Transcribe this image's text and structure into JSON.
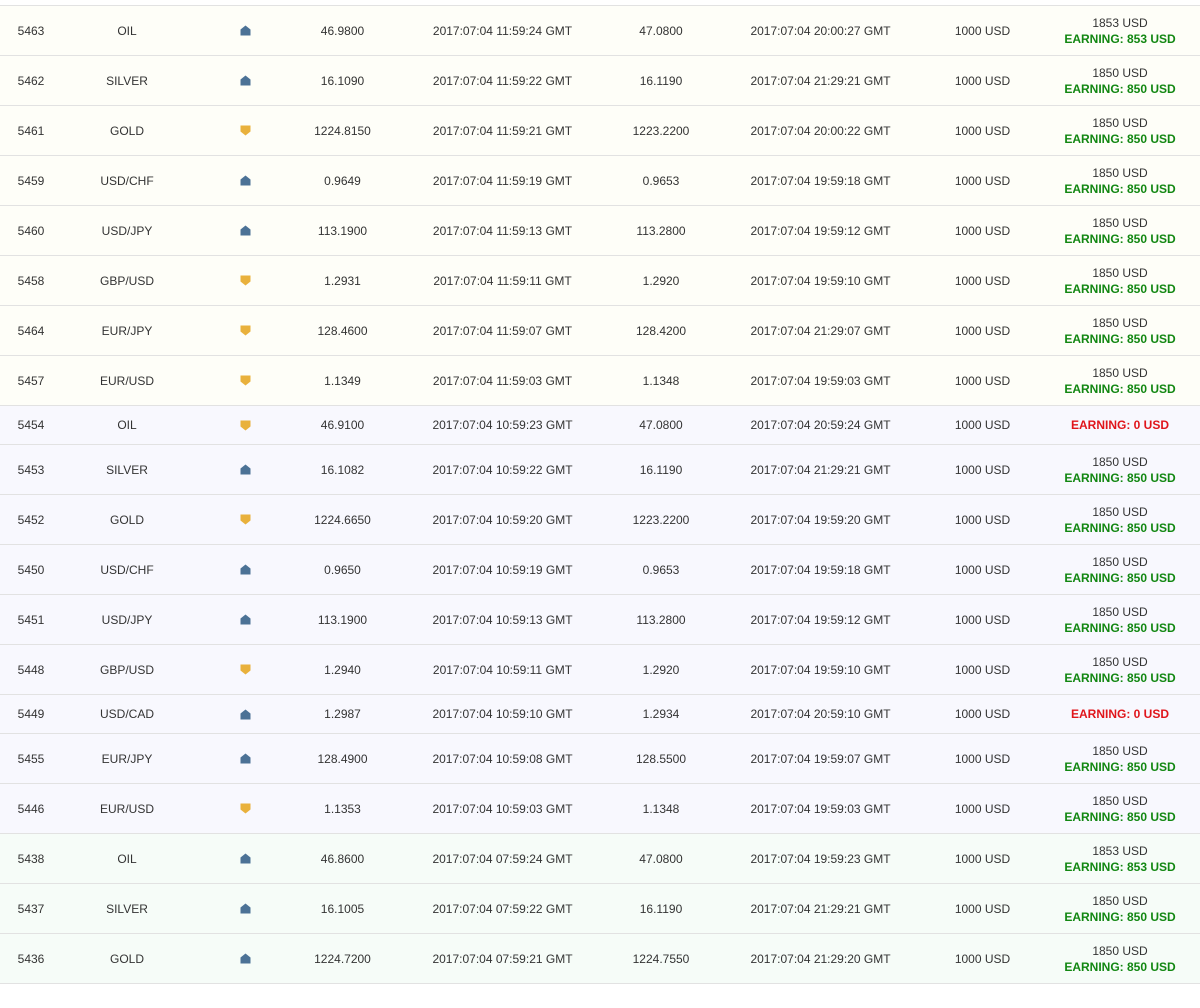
{
  "colors": {
    "up": "#4c7296",
    "down": "#e9b13c",
    "earning_positive": "#128712",
    "earning_zero": "#e0151b"
  },
  "trades": [
    {
      "id": "5463",
      "asset": "OIL",
      "direction": "up",
      "open_price": "46.9800",
      "open_time": "2017:07:04 11:59:24 GMT",
      "close_price": "47.0800",
      "close_time": "2017:07:04 20:00:27 GMT",
      "investment": "1000 USD",
      "payout": "1853 USD",
      "earning": "EARNING: 853 USD",
      "group": "yellow"
    },
    {
      "id": "5462",
      "asset": "SILVER",
      "direction": "up",
      "open_price": "16.1090",
      "open_time": "2017:07:04 11:59:22 GMT",
      "close_price": "16.1190",
      "close_time": "2017:07:04 21:29:21 GMT",
      "investment": "1000 USD",
      "payout": "1850 USD",
      "earning": "EARNING: 850 USD",
      "group": "yellow"
    },
    {
      "id": "5461",
      "asset": "GOLD",
      "direction": "down",
      "open_price": "1224.8150",
      "open_time": "2017:07:04 11:59:21 GMT",
      "close_price": "1223.2200",
      "close_time": "2017:07:04 20:00:22 GMT",
      "investment": "1000 USD",
      "payout": "1850 USD",
      "earning": "EARNING: 850 USD",
      "group": "yellow"
    },
    {
      "id": "5459",
      "asset": "USD/CHF",
      "direction": "up",
      "open_price": "0.9649",
      "open_time": "2017:07:04 11:59:19 GMT",
      "close_price": "0.9653",
      "close_time": "2017:07:04 19:59:18 GMT",
      "investment": "1000 USD",
      "payout": "1850 USD",
      "earning": "EARNING: 850 USD",
      "group": "yellow"
    },
    {
      "id": "5460",
      "asset": "USD/JPY",
      "direction": "up",
      "open_price": "113.1900",
      "open_time": "2017:07:04 11:59:13 GMT",
      "close_price": "113.2800",
      "close_time": "2017:07:04 19:59:12 GMT",
      "investment": "1000 USD",
      "payout": "1850 USD",
      "earning": "EARNING: 850 USD",
      "group": "yellow"
    },
    {
      "id": "5458",
      "asset": "GBP/USD",
      "direction": "down",
      "open_price": "1.2931",
      "open_time": "2017:07:04 11:59:11 GMT",
      "close_price": "1.2920",
      "close_time": "2017:07:04 19:59:10 GMT",
      "investment": "1000 USD",
      "payout": "1850 USD",
      "earning": "EARNING: 850 USD",
      "group": "yellow"
    },
    {
      "id": "5464",
      "asset": "EUR/JPY",
      "direction": "down",
      "open_price": "128.4600",
      "open_time": "2017:07:04 11:59:07 GMT",
      "close_price": "128.4200",
      "close_time": "2017:07:04 21:29:07 GMT",
      "investment": "1000 USD",
      "payout": "1850 USD",
      "earning": "EARNING: 850 USD",
      "group": "yellow"
    },
    {
      "id": "5457",
      "asset": "EUR/USD",
      "direction": "down",
      "open_price": "1.1349",
      "open_time": "2017:07:04 11:59:03 GMT",
      "close_price": "1.1348",
      "close_time": "2017:07:04 19:59:03 GMT",
      "investment": "1000 USD",
      "payout": "1850 USD",
      "earning": "EARNING: 850 USD",
      "group": "yellow"
    },
    {
      "id": "5454",
      "asset": "OIL",
      "direction": "down",
      "open_price": "46.9100",
      "open_time": "2017:07:04 10:59:23 GMT",
      "close_price": "47.0800",
      "close_time": "2017:07:04 20:59:24 GMT",
      "investment": "1000 USD",
      "payout": "",
      "earning": "EARNING: 0 USD",
      "group": "lav"
    },
    {
      "id": "5453",
      "asset": "SILVER",
      "direction": "up",
      "open_price": "16.1082",
      "open_time": "2017:07:04 10:59:22 GMT",
      "close_price": "16.1190",
      "close_time": "2017:07:04 21:29:21 GMT",
      "investment": "1000 USD",
      "payout": "1850 USD",
      "earning": "EARNING: 850 USD",
      "group": "lav"
    },
    {
      "id": "5452",
      "asset": "GOLD",
      "direction": "down",
      "open_price": "1224.6650",
      "open_time": "2017:07:04 10:59:20 GMT",
      "close_price": "1223.2200",
      "close_time": "2017:07:04 19:59:20 GMT",
      "investment": "1000 USD",
      "payout": "1850 USD",
      "earning": "EARNING: 850 USD",
      "group": "lav"
    },
    {
      "id": "5450",
      "asset": "USD/CHF",
      "direction": "up",
      "open_price": "0.9650",
      "open_time": "2017:07:04 10:59:19 GMT",
      "close_price": "0.9653",
      "close_time": "2017:07:04 19:59:18 GMT",
      "investment": "1000 USD",
      "payout": "1850 USD",
      "earning": "EARNING: 850 USD",
      "group": "lav"
    },
    {
      "id": "5451",
      "asset": "USD/JPY",
      "direction": "up",
      "open_price": "113.1900",
      "open_time": "2017:07:04 10:59:13 GMT",
      "close_price": "113.2800",
      "close_time": "2017:07:04 19:59:12 GMT",
      "investment": "1000 USD",
      "payout": "1850 USD",
      "earning": "EARNING: 850 USD",
      "group": "lav"
    },
    {
      "id": "5448",
      "asset": "GBP/USD",
      "direction": "down",
      "open_price": "1.2940",
      "open_time": "2017:07:04 10:59:11 GMT",
      "close_price": "1.2920",
      "close_time": "2017:07:04 19:59:10 GMT",
      "investment": "1000 USD",
      "payout": "1850 USD",
      "earning": "EARNING: 850 USD",
      "group": "lav"
    },
    {
      "id": "5449",
      "asset": "USD/CAD",
      "direction": "up",
      "open_price": "1.2987",
      "open_time": "2017:07:04 10:59:10 GMT",
      "close_price": "1.2934",
      "close_time": "2017:07:04 20:59:10 GMT",
      "investment": "1000 USD",
      "payout": "",
      "earning": "EARNING: 0 USD",
      "group": "lav"
    },
    {
      "id": "5455",
      "asset": "EUR/JPY",
      "direction": "up",
      "open_price": "128.4900",
      "open_time": "2017:07:04 10:59:08 GMT",
      "close_price": "128.5500",
      "close_time": "2017:07:04 19:59:07 GMT",
      "investment": "1000 USD",
      "payout": "1850 USD",
      "earning": "EARNING: 850 USD",
      "group": "lav"
    },
    {
      "id": "5446",
      "asset": "EUR/USD",
      "direction": "down",
      "open_price": "1.1353",
      "open_time": "2017:07:04 10:59:03 GMT",
      "close_price": "1.1348",
      "close_time": "2017:07:04 19:59:03 GMT",
      "investment": "1000 USD",
      "payout": "1850 USD",
      "earning": "EARNING: 850 USD",
      "group": "lav"
    },
    {
      "id": "5438",
      "asset": "OIL",
      "direction": "up",
      "open_price": "46.8600",
      "open_time": "2017:07:04 07:59:24 GMT",
      "close_price": "47.0800",
      "close_time": "2017:07:04 19:59:23 GMT",
      "investment": "1000 USD",
      "payout": "1853 USD",
      "earning": "EARNING: 853 USD",
      "group": "mint"
    },
    {
      "id": "5437",
      "asset": "SILVER",
      "direction": "up",
      "open_price": "16.1005",
      "open_time": "2017:07:04 07:59:22 GMT",
      "close_price": "16.1190",
      "close_time": "2017:07:04 21:29:21 GMT",
      "investment": "1000 USD",
      "payout": "1850 USD",
      "earning": "EARNING: 850 USD",
      "group": "mint"
    },
    {
      "id": "5436",
      "asset": "GOLD",
      "direction": "up",
      "open_price": "1224.7200",
      "open_time": "2017:07:04 07:59:21 GMT",
      "close_price": "1224.7550",
      "close_time": "2017:07:04 21:29:20 GMT",
      "investment": "1000 USD",
      "payout": "1850 USD",
      "earning": "EARNING: 850 USD",
      "group": "mint"
    }
  ]
}
